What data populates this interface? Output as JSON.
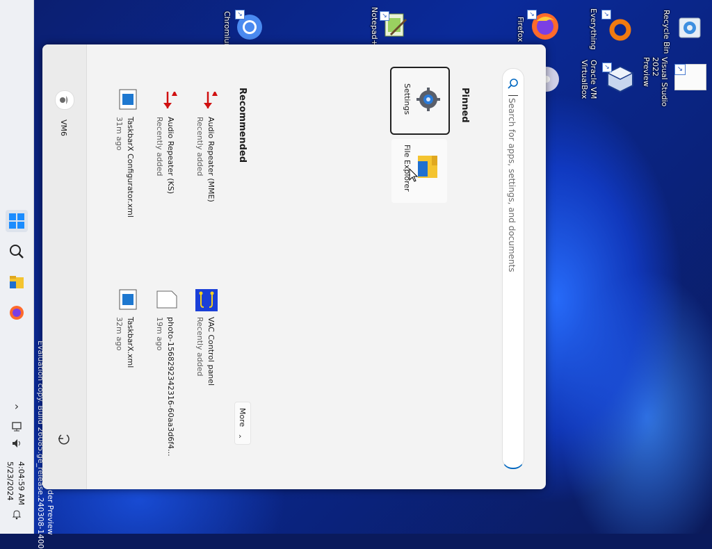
{
  "desktop": {
    "icons": [
      {
        "label": "Recycle Bin",
        "icon": "recycle-bin-icon"
      },
      {
        "label": "Visual Studio 2022 Preview",
        "icon": "visual-studio-shortcut-icon"
      },
      {
        "label": "Everything",
        "icon": "everything-icon"
      },
      {
        "label": "Oracle VM VirtualBox",
        "icon": "virtualbox-icon"
      },
      {
        "label": "Firefox",
        "icon": "firefox-icon"
      },
      {
        "label": "Notepad++",
        "icon": "notepadpp-icon"
      },
      {
        "label": "Chromium",
        "icon": "chromium-icon"
      }
    ],
    "watermark": "Evaluation copy. Build 26085.ge_release.240308-1400",
    "watermark_tail": "der Preview"
  },
  "start_menu": {
    "search_placeholder": "Search for apps, settings, and documents",
    "pinned_heading": "Pinned",
    "pinned": [
      {
        "label": "Settings",
        "icon": "settings-gear-icon"
      },
      {
        "label": "File Explorer",
        "icon": "file-explorer-icon"
      }
    ],
    "recommended_heading": "Recommended",
    "more_label": "More",
    "recommended": [
      {
        "name": "Audio Repeater (MME)",
        "sub": "Recently added",
        "icon": "audio-repeater-icon"
      },
      {
        "name": "Audio Repeater (KS)",
        "sub": "Recently added",
        "icon": "audio-repeater-icon"
      },
      {
        "name": "TaskbarX Configurator.xml",
        "sub": "31m ago",
        "icon": "xml-file-icon"
      },
      {
        "name": "VAC Control panel",
        "sub": "Recently added",
        "icon": "vac-control-icon"
      },
      {
        "name": "photo-1568292342316-60aa3d6f4...",
        "sub": "19m ago",
        "icon": "blank-file-icon"
      },
      {
        "name": "TaskbarX.xml",
        "sub": "32m ago",
        "icon": "xml-file-icon"
      }
    ],
    "user_name": "VM6"
  },
  "taskbar": {
    "time": "4:04:59 AM",
    "date": "5/23/2024"
  },
  "colors": {
    "accent": "#0067c0",
    "menu_bg": "#f3f3f3",
    "taskbar_bg": "#eef0f4"
  }
}
